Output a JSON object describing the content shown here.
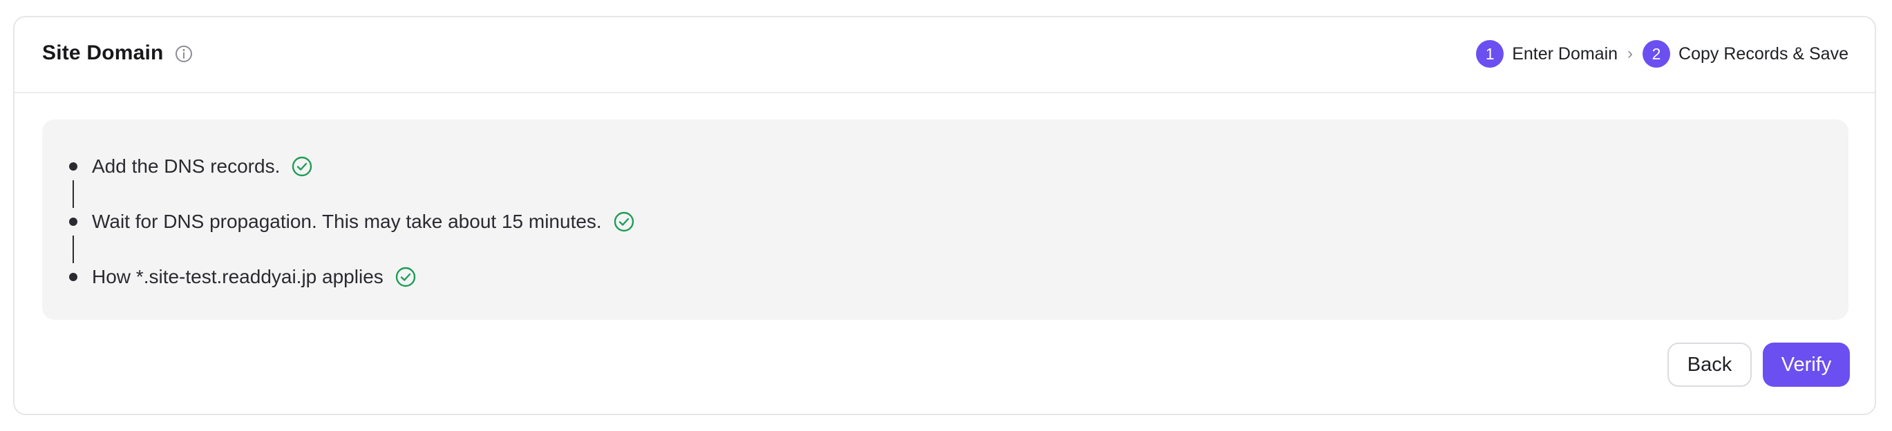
{
  "header": {
    "title": "Site Domain",
    "info_icon": "info-circle-icon"
  },
  "steps": [
    {
      "number": "1",
      "label": "Enter Domain"
    },
    {
      "number": "2",
      "label": "Copy Records & Save"
    }
  ],
  "step_separator": "›",
  "records": [
    {
      "text": "Add the DNS records.",
      "status_icon": "check-circle-icon"
    },
    {
      "text": "Wait for DNS propagation. This may take about 15 minutes.",
      "status_icon": "check-circle-icon"
    },
    {
      "text": "How *.site-test.readdyai.jp applies",
      "status_icon": "check-circle-icon"
    }
  ],
  "actions": {
    "back_label": "Back",
    "verify_label": "Verify"
  },
  "colors": {
    "accent": "#6b4ff0",
    "success": "#1f9d55",
    "panel_bg": "#f4f4f5",
    "border": "#e6e6e9"
  }
}
